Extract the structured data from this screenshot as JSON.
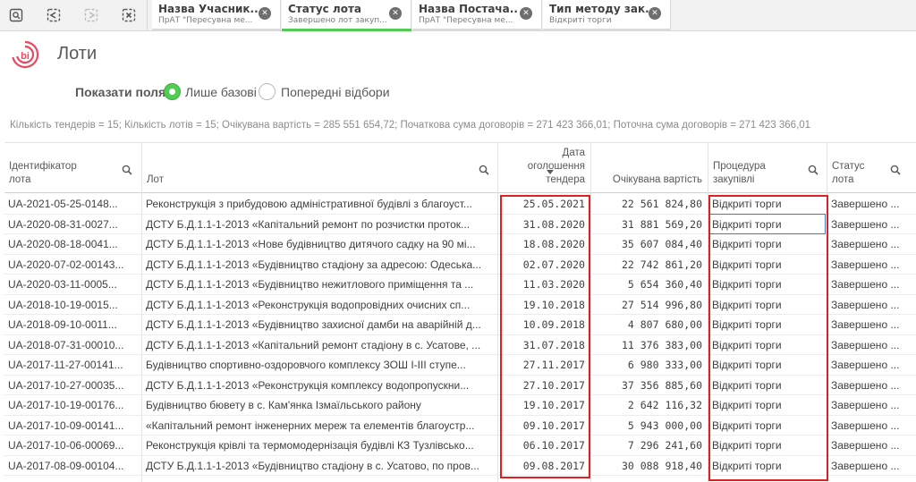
{
  "toolbar": {
    "icons": [
      "search-selections-icon",
      "step-back-icon",
      "step-forward-icon",
      "clear-selections-icon"
    ]
  },
  "selections": [
    {
      "title": "Назва Учасник...",
      "subtitle": "ПрАТ \"Пересувна ме...",
      "bar_color": "#dadada"
    },
    {
      "title": "Статус лота",
      "subtitle": "Завершено лот закуп...",
      "bar_color": "#52cc52"
    },
    {
      "title": "Назва Постача...",
      "subtitle": "ПрАТ \"Пересувна ме...",
      "bar_color": "#dadada"
    },
    {
      "title": "Тип методу зак...",
      "subtitle": "Відкриті торги",
      "bar_color": "#dadada"
    }
  ],
  "header": {
    "title": "Лоти",
    "logo_text": "bi"
  },
  "fields": {
    "label": "Показати поля:",
    "options": [
      {
        "label": "Лише базові",
        "selected": true
      },
      {
        "label": "Попередні відбори",
        "selected": false
      }
    ]
  },
  "summary": "Кількість тендерів = 15; Кількість лотів = 15; Очікувана вартість = 285 551 654,72; Початкова сума договорів = 271 423 366,01; Поточна сума договорів = 271 423 366,01",
  "table": {
    "columns": [
      {
        "label_line1": "Ідентифікатор",
        "label_line2": "лота"
      },
      {
        "label_line1": "Лот"
      },
      {
        "label_line1": "Дата",
        "label_line2": "оголошення",
        "label_line3": "тендера"
      },
      {
        "label_line1": "Очікувана вартість"
      },
      {
        "label_line1": "Процедура",
        "label_line2": "закупівлі"
      },
      {
        "label_line1": "Статус",
        "label_line2": "лота"
      }
    ],
    "rows": [
      [
        "UA-2021-05-25-0148...",
        "Реконструкція з прибудовою адміністративної будівлі з благоуст...",
        "25.05.2021",
        "22 561 824,80",
        "Відкриті торги",
        "Завершено ..."
      ],
      [
        "UA-2020-08-31-0027...",
        "ДСТУ Б.Д.1.1-1-2013 «Капітальний ремонт по розчистки проток...",
        "31.08.2020",
        "31 881 569,20",
        "Відкриті торги",
        "Завершено ..."
      ],
      [
        "UA-2020-08-18-0041...",
        "ДСТУ Б.Д.1.1-1-2013 «Нове будівництво дитячого садку на 90 мі...",
        "18.08.2020",
        "35 607 084,40",
        "Відкриті торги",
        "Завершено ..."
      ],
      [
        "UA-2020-07-02-00143...",
        "ДСТУ Б.Д.1.1-1-2013 «Будівництво стадіону за адресою: Одеська...",
        "02.07.2020",
        "22 742 861,20",
        "Відкриті торги",
        "Завершено ..."
      ],
      [
        "UA-2020-03-11-0005...",
        "ДСТУ Б.Д.1.1-1-2013 «Будівництво нежитлового приміщення та ...",
        "11.03.2020",
        "5 654 360,40",
        "Відкриті торги",
        "Завершено ..."
      ],
      [
        "UA-2018-10-19-0015...",
        "ДСТУ Б.Д.1.1-1-2013 «Реконструкція водопровідних очисних сп...",
        "19.10.2018",
        "27 514 996,80",
        "Відкриті торги",
        "Завершено ..."
      ],
      [
        "UA-2018-09-10-0011...",
        "ДСТУ Б.Д.1.1-1-2013 «Будівництво захисної дамби на аварійній д...",
        "10.09.2018",
        "4 807 680,00",
        "Відкриті торги",
        "Завершено ..."
      ],
      [
        "UA-2018-07-31-00010...",
        "ДСТУ Б.Д.1.1-1-2013 «Капітальний ремонт стадіону в с. Усатове, ...",
        "31.07.2018",
        "11 376 383,00",
        "Відкриті торги",
        "Завершено ..."
      ],
      [
        "UA-2017-11-27-00141...",
        "Будівництво спортивно-оздоровчого комплексу ЗОШ І-ІІІ ступе...",
        "27.11.2017",
        "6 980 333,00",
        "Відкриті торги",
        "Завершено ..."
      ],
      [
        "UA-2017-10-27-00035...",
        "ДСТУ Б.Д.1.1-1-2013 «Реконструкція комплексу водопропускни...",
        "27.10.2017",
        "37 356 885,60",
        "Відкриті торги",
        "Завершено ..."
      ],
      [
        "UA-2017-10-19-00176...",
        "Будівництво бювету в с. Кам'янка Ізмаїльського району",
        "19.10.2017",
        "2 642 116,32",
        "Відкриті торги",
        "Завершено ..."
      ],
      [
        "UA-2017-10-09-00141...",
        "«Капітальний ремонт інженерних мереж та елементів благоустр...",
        "09.10.2017",
        "5 943 000,00",
        "Відкриті торги",
        "Завершено ..."
      ],
      [
        "UA-2017-10-06-00069...",
        "Реконструкція крівлі та термомодернізація будівлі КЗ Тузлівсько...",
        "06.10.2017",
        "7 296 241,60",
        "Відкриті торги",
        "Завершено ..."
      ],
      [
        "UA-2017-08-09-00104...",
        "ДСТУ Б.Д.1.1-1-2013 «Будівництво стадіону в с. Усатово, по пров...",
        "09.08.2017",
        "30 088 918,40",
        "Відкриті торги",
        "Завершено ..."
      ]
    ]
  },
  "colors": {
    "accent_green": "#52cc52",
    "highlight_red": "#e02020",
    "focus_blue": "#3b7bbf"
  }
}
